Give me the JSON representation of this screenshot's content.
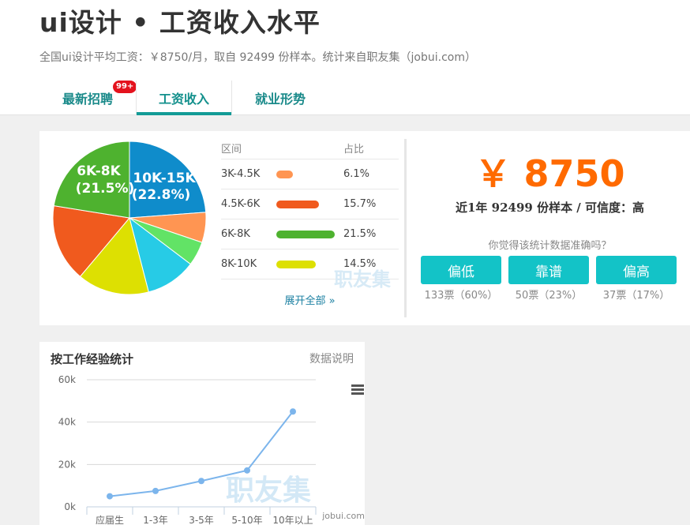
{
  "header": {
    "title": "ui设计 • 工资收入水平",
    "subtitle": "全国ui设计平均工资：￥8750/月，取自 92499 份样本。统计来自职友集（jobui.com）",
    "tabs": [
      {
        "label": "最新招聘",
        "badge": "99+"
      },
      {
        "label": "工资收入"
      },
      {
        "label": "就业形势"
      }
    ]
  },
  "distribution": {
    "col_range": "区间",
    "col_ratio": "占比",
    "rows": [
      {
        "range": "3K-4.5K",
        "ratio": "6.1%",
        "value": 6.1,
        "color": "#ff9552"
      },
      {
        "range": "4.5K-6K",
        "ratio": "15.7%",
        "value": 15.7,
        "color": "#f05a1e"
      },
      {
        "range": "6K-8K",
        "ratio": "21.5%",
        "value": 21.5,
        "color": "#4eb22f"
      },
      {
        "range": "8K-10K",
        "ratio": "14.5%",
        "value": 14.5,
        "color": "#dde002"
      }
    ],
    "expand": "展开全部 »",
    "watermark": "职友集"
  },
  "chart_data": [
    {
      "type": "pie",
      "slices": [
        {
          "label": "10K-15K",
          "value": 22.8,
          "color": "#0f8ccb",
          "data_label": "10K-15K\n(22.8%)"
        },
        {
          "label": "3K-4.5K",
          "value": 6.1,
          "color": "#ff9552"
        },
        {
          "label": "",
          "value": 4.9,
          "color": "#62e366"
        },
        {
          "label": "",
          "value": 10.2,
          "color": "#27cbe6"
        },
        {
          "label": "8K-10K",
          "value": 14.5,
          "color": "#dde002"
        },
        {
          "label": "4.5K-6K",
          "value": 15.7,
          "color": "#f05a1e"
        },
        {
          "label": "6K-8K",
          "value": 21.5,
          "color": "#4eb22f",
          "data_label": "6K-8K\n(21.5%)"
        }
      ],
      "labels": {
        "l1": "10K-15K",
        "l1b": "(22.8%)",
        "l2": "6K-8K",
        "l2b": "(21.5%)"
      }
    },
    {
      "type": "line",
      "title": "按工作经验统计",
      "categories": [
        "应届生",
        "1-3年",
        "3-5年",
        "5-10年",
        "10年以上"
      ],
      "series": [
        {
          "values": [
            5000,
            7500,
            12200,
            17200,
            45000
          ],
          "color": "#7cb5ec"
        }
      ],
      "yticks": [
        "0k",
        "20k",
        "40k",
        "60k"
      ],
      "ylim": [
        0,
        60000
      ]
    }
  ],
  "summary": {
    "salary": "￥ 8750",
    "meta": "近1年 92499 份样本 / 可信度：高",
    "question": "你觉得该统计数据准确吗？",
    "votes": [
      {
        "label": "偏低",
        "count": "133票（60%）"
      },
      {
        "label": "靠谱",
        "count": "50票（23%）"
      },
      {
        "label": "偏高",
        "count": "37票（17%）"
      }
    ]
  },
  "experience": {
    "title": "按工作经验统计",
    "link": "数据说明",
    "watermark": "职友集",
    "credit": "jobui.com"
  },
  "icons": {
    "menu": "hamburger-menu-icon"
  }
}
